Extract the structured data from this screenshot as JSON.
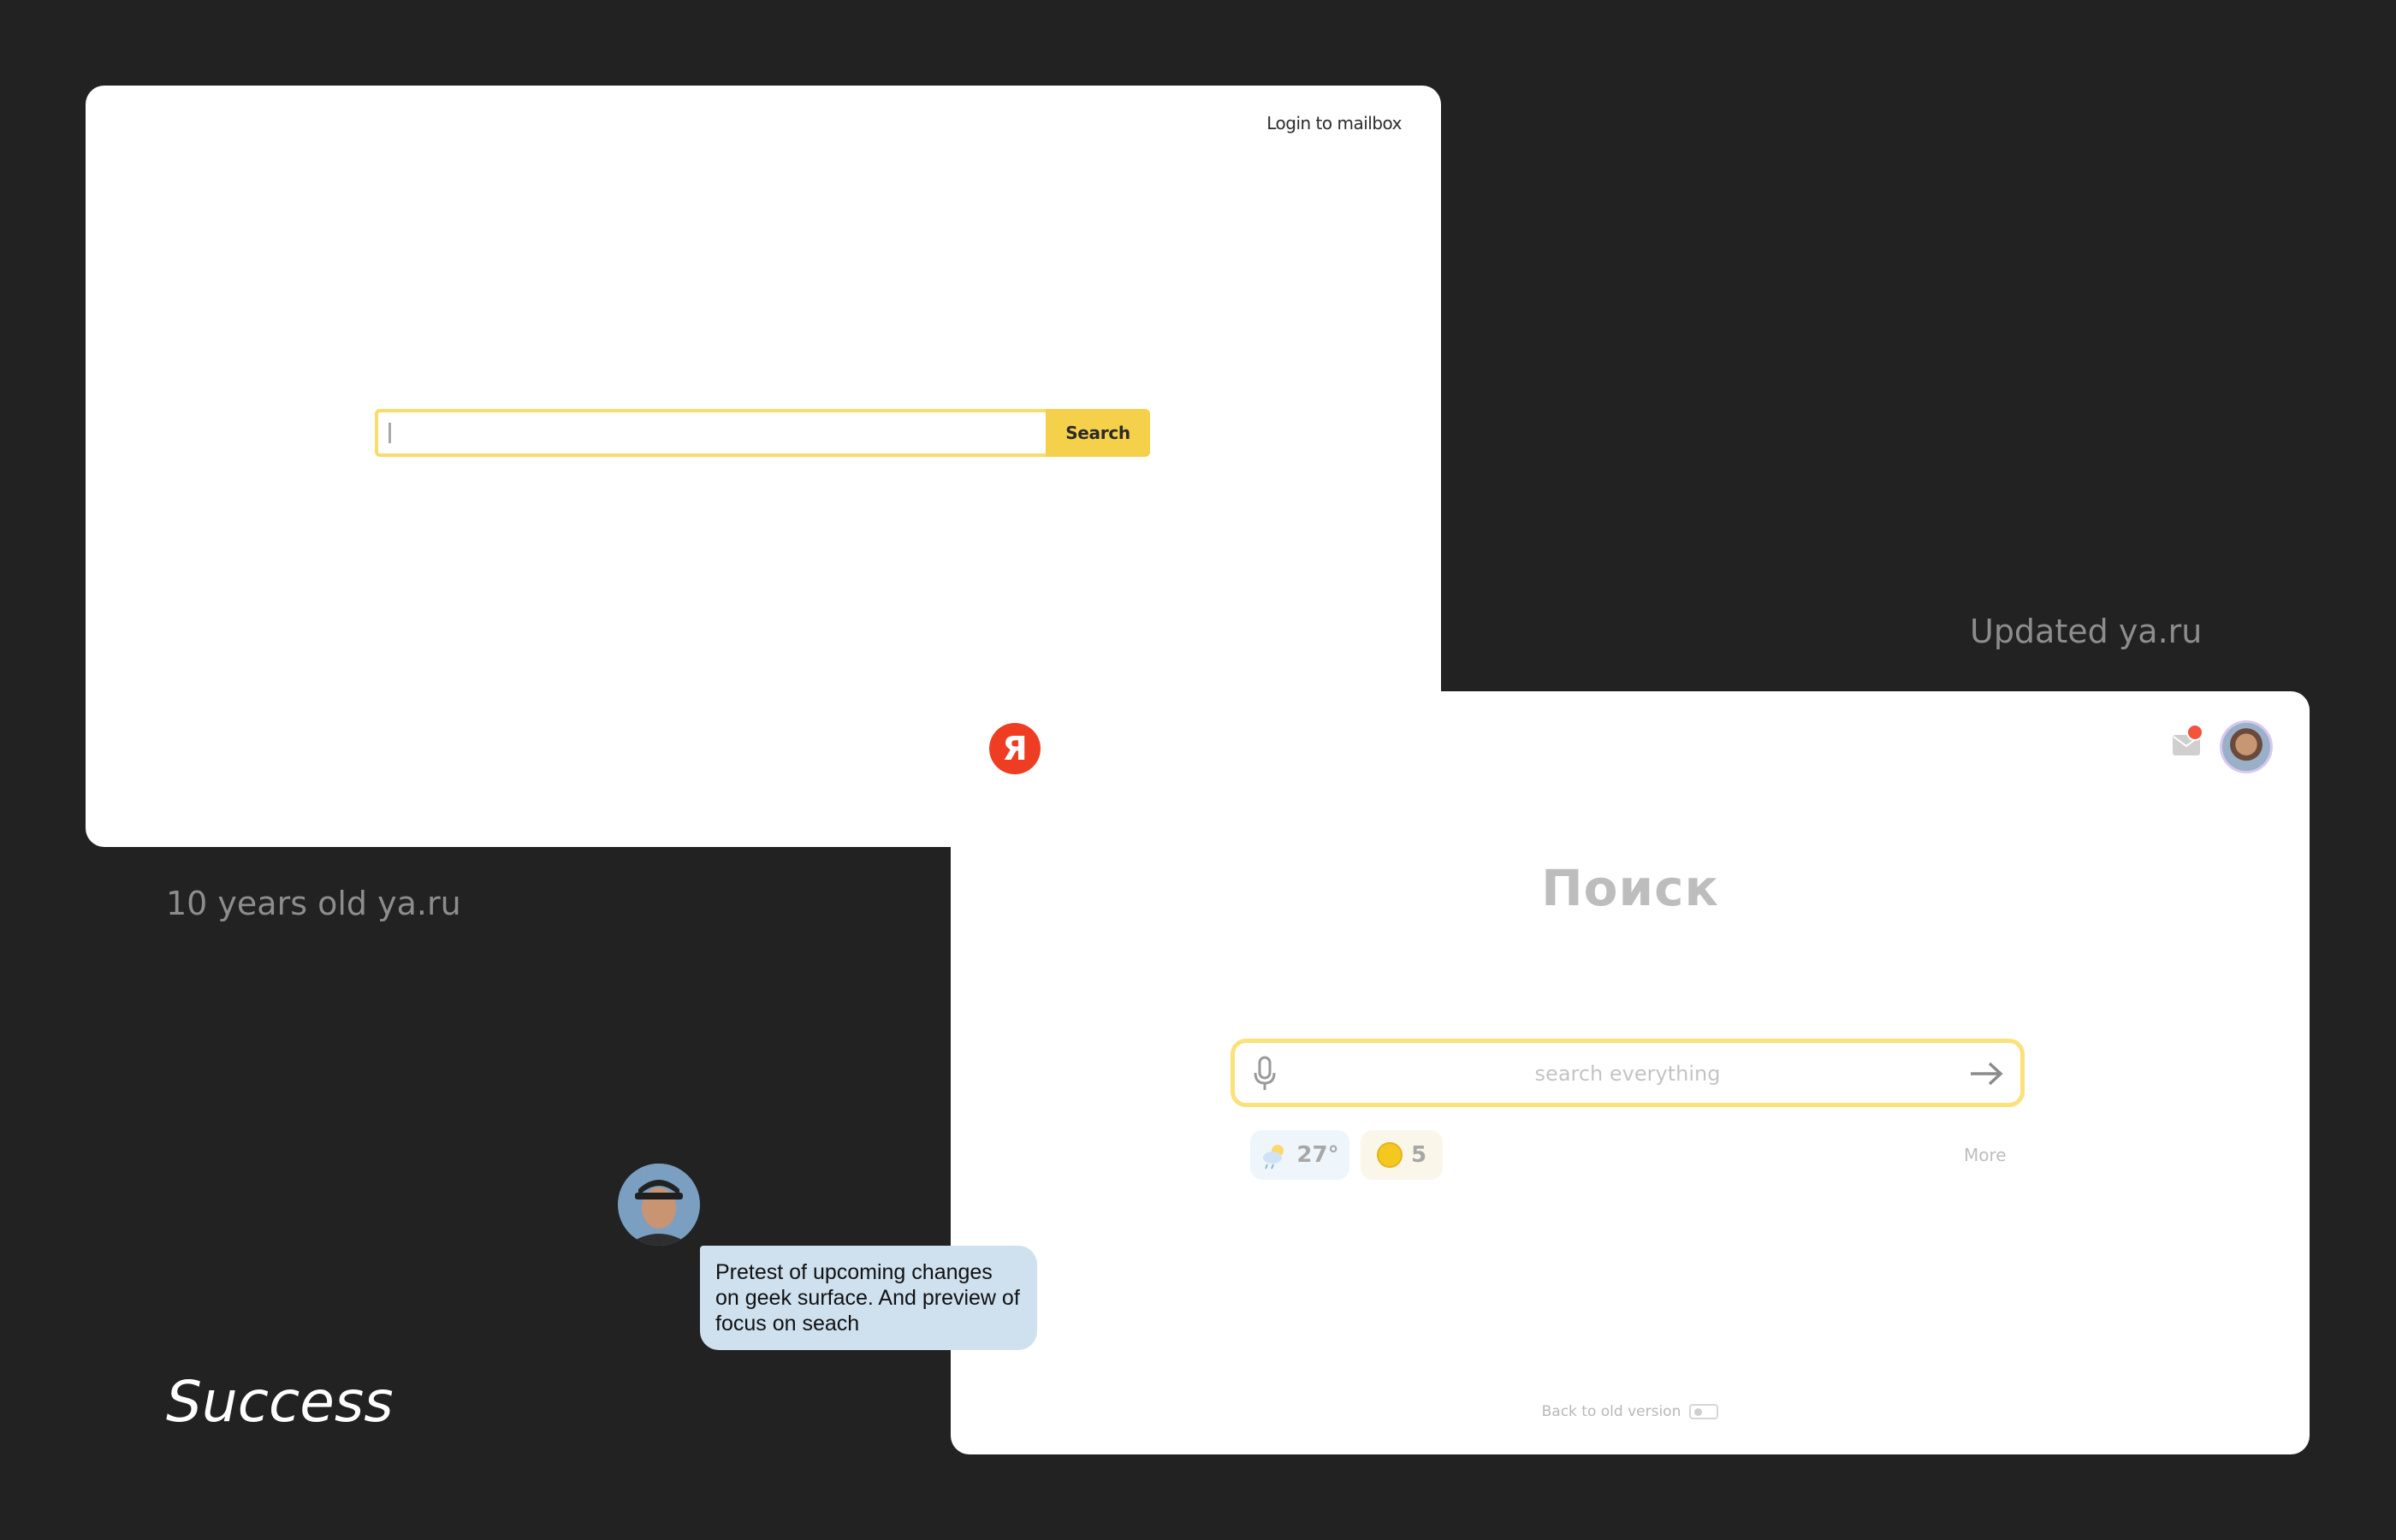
{
  "old_screen": {
    "login_link": "Login to mailbox",
    "search_button": "Search",
    "caption": "10 years old ya.ru"
  },
  "new_screen": {
    "logo": "Я",
    "title": "Поиск",
    "search_placeholder": "search everything",
    "weather_temp": "27°",
    "score_value": "5",
    "more_link": "More",
    "back_to_old": "Back to old version",
    "caption": "Updated ya.ru",
    "icons": [
      "ya-logo-icon",
      "mail-icon",
      "avatar",
      "mic-icon",
      "arrow-right-icon",
      "weather-icon",
      "coin-icon"
    ],
    "colors": {
      "logo_red": "#ef3d23",
      "search_border": "#fae27a",
      "notification": "#f2553b"
    }
  },
  "footer": {
    "status": "Success"
  },
  "comment": {
    "text": "Pretest of upcoming changes on geek surface. And preview of focus on seach"
  }
}
